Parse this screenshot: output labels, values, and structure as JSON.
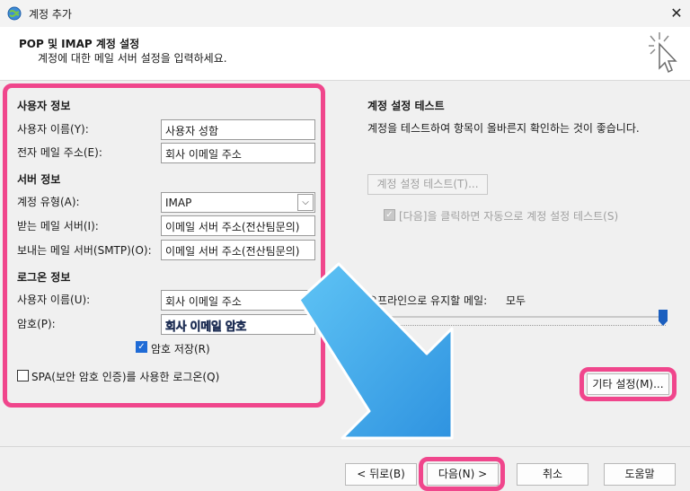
{
  "window": {
    "title": "계정 추가",
    "close_icon": "close-icon"
  },
  "header": {
    "title": "POP 및 IMAP 계정 설정",
    "subtitle": "계정에 대한 메일 서버 설정을 입력하세요."
  },
  "user_info": {
    "section_title": "사용자 정보",
    "name_label": "사용자 이름(Y):",
    "name_value": "사용자 성함",
    "email_label": "전자 메일 주소(E):",
    "email_value": "회사 이메일 주소"
  },
  "server_info": {
    "section_title": "서버 정보",
    "account_type_label": "계정 유형(A):",
    "account_type_value": "IMAP",
    "incoming_label": "받는 메일 서버(I):",
    "incoming_value": "이메일 서버 주소(전산팀문의)",
    "outgoing_label": "보내는 메일 서버(SMTP)(O):",
    "outgoing_value": "이메일 서버 주소(전산팀문의)"
  },
  "logon_info": {
    "section_title": "로그온 정보",
    "username_label": "사용자 이름(U):",
    "username_value": "회사 이메일 주소",
    "password_label": "암호(P):",
    "password_value": "회사 이메일 암호",
    "save_password_label": "암호 저장(R)",
    "save_password_checked": true,
    "spa_label": "SPA(보안 암호 인증)를 사용한 로그온(Q)",
    "spa_checked": false
  },
  "test": {
    "section_title": "계정 설정 테스트",
    "description": "계정을 테스트하여 항목이 올바른지 확인하는 것이 좋습니다.",
    "test_button": "계정 설정 테스트(T)...",
    "auto_test_label": "[다음]을 클릭하면 자동으로 계정 설정 테스트(S)",
    "auto_test_checked": true
  },
  "offline": {
    "label": "오프라인으로 유지할 메일:",
    "value": "모두",
    "slider_fraction": 1.0
  },
  "more_settings_button": "기타 설정(M)...",
  "footer": {
    "back": "< 뒤로(B)",
    "next": "다음(N) >",
    "cancel": "취소",
    "help": "도움말"
  },
  "colors": {
    "highlight": "#f0468c",
    "arrow": "#3ea6ea",
    "checkbox_accent": "#1f6bd6"
  }
}
